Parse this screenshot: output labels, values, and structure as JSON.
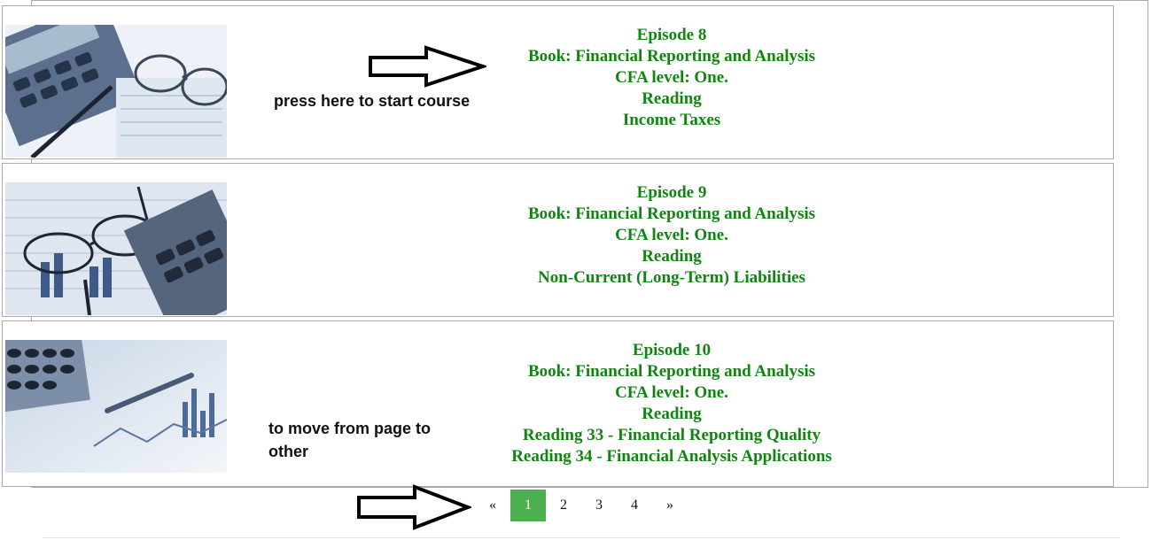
{
  "hints": {
    "start_course": "press here to start course",
    "move_page": "to move from page to other"
  },
  "episodes": [
    {
      "lines": [
        "Episode 8",
        "Book: Financial Reporting and Analysis",
        "CFA level: One.",
        "Reading",
        "Income Taxes"
      ],
      "image_icon": "calculator-glasses-image"
    },
    {
      "lines": [
        "Episode 9",
        "Book: Financial Reporting and Analysis",
        "CFA level: One.",
        "Reading",
        "Non-Current (Long-Term) Liabilities"
      ],
      "image_icon": "glasses-calculator-chart-image"
    },
    {
      "lines": [
        "Episode 10",
        "Book: Financial Reporting and Analysis",
        "CFA level: One.",
        "Reading",
        "Reading 33 - Financial Reporting Quality",
        "Reading 34 - Financial Analysis Applications"
      ],
      "image_icon": "calculator-pen-chart-image"
    }
  ],
  "pagination": {
    "prev": "«",
    "pages": [
      "1",
      "2",
      "3",
      "4"
    ],
    "next": "»",
    "current": "1"
  },
  "colors": {
    "episode_text": "#138413",
    "active_page": "#4caf50"
  }
}
